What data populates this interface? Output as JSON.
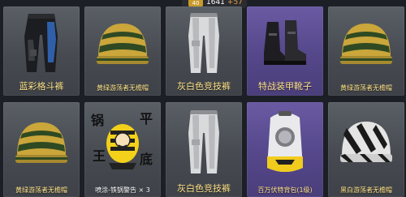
{
  "top_bar": {
    "level_badge": "40",
    "counter": "1641",
    "counter_delta": "+57"
  },
  "items": [
    {
      "name": "蓝彩格斗裤",
      "rarity": "gray"
    },
    {
      "name": "黄绿游荡者无檐帽",
      "rarity": "gray"
    },
    {
      "name": "灰白色竞技裤",
      "rarity": "gray"
    },
    {
      "name": "特战装甲靴子",
      "rarity": "purple"
    },
    {
      "name": "黄绿游荡者无檐帽",
      "rarity": "gray"
    },
    {
      "name": "黄绿游荡者无檐帽",
      "rarity": "gray"
    },
    {
      "name": "喷涂-铁锅警告 × 3",
      "rarity": "gray"
    },
    {
      "name": "灰白色竞技裤",
      "rarity": "gray"
    },
    {
      "name": "百万伏特背包(1级)",
      "rarity": "purple"
    },
    {
      "name": "黑白游荡者无檐帽",
      "rarity": "gray"
    }
  ],
  "sticker_text": {
    "top_left": "锅",
    "top_right": "平",
    "bottom_left": "王",
    "bottom_right": "底"
  },
  "colors": {
    "card_gray": "#4a4e54",
    "card_purple": "#5a4b92",
    "label_yellow": "#ffe38a",
    "background": "#1c1f25"
  }
}
